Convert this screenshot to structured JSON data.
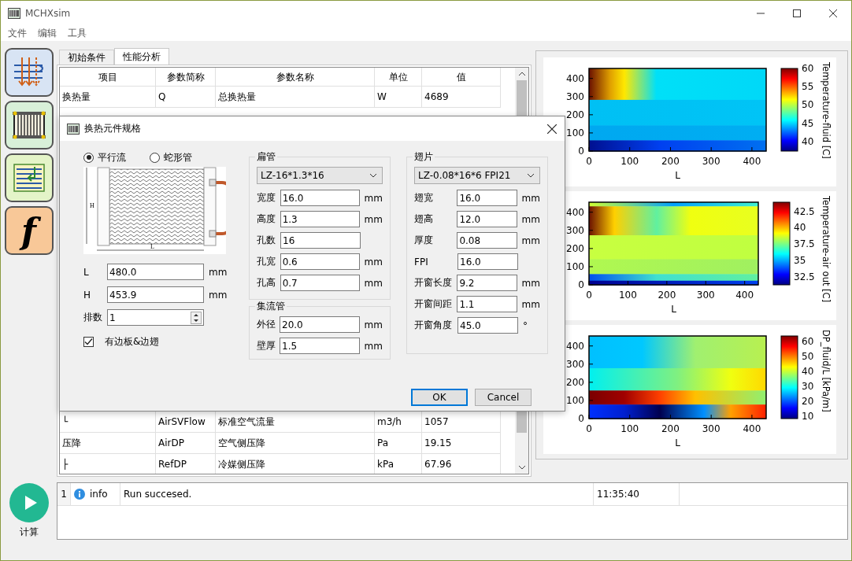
{
  "window": {
    "title": "MCHXsim"
  },
  "menu": [
    "文件",
    "编辑",
    "工具"
  ],
  "toolbar": [
    {
      "kind": "flow"
    },
    {
      "kind": "radiator"
    },
    {
      "kind": "list"
    },
    {
      "kind": "function",
      "label": "f"
    }
  ],
  "run_button": {
    "label": "计算"
  },
  "tabs": [
    {
      "label": "初始条件",
      "selected": false
    },
    {
      "label": "性能分析",
      "selected": true
    }
  ],
  "table": {
    "columns": [
      "项目",
      "参数简称",
      "参数名称",
      "单位",
      "值"
    ],
    "rows": [
      [
        "换热量",
        "Q",
        "总换热量",
        "W",
        "4689"
      ]
    ],
    "rows_below": [
      [
        "└",
        "AirSVFlow",
        "标准空气流量",
        "m3/h",
        "1057"
      ],
      [
        "压降",
        "AirDP",
        "空气侧压降",
        "Pa",
        "19.15"
      ],
      [
        "├",
        "RefDP",
        "冷媒侧压降",
        "kPa",
        "67.96"
      ]
    ]
  },
  "plots": [
    {
      "title": "Temperature-fluid [C]",
      "xlabel": "L",
      "xticks": [
        "0",
        "100",
        "200",
        "300",
        "400"
      ],
      "yticks": [
        "400",
        "300",
        "200",
        "100",
        "0"
      ],
      "colorbar_ticks": [
        "60",
        "55",
        "50",
        "45",
        "40"
      ]
    },
    {
      "title": "Temperature-air out [C]",
      "xlabel": "L",
      "xticks": [
        "0",
        "100",
        "200",
        "300",
        "400"
      ],
      "yticks": [
        "400",
        "300",
        "200",
        "100",
        "0"
      ],
      "colorbar_ticks": [
        "42.5",
        "40",
        "37.5",
        "35",
        "32.5"
      ]
    },
    {
      "title": "DP_fluid/L [kPa/m]",
      "xlabel": "L",
      "xticks": [
        "0",
        "100",
        "200",
        "300",
        "400"
      ],
      "yticks": [
        "400",
        "300",
        "200",
        "100",
        "0"
      ],
      "colorbar_ticks": [
        "60",
        "50",
        "40",
        "30",
        "20",
        "10"
      ]
    }
  ],
  "log": {
    "rows": [
      {
        "line": "1",
        "kind": "info",
        "label": "info",
        "message": "Run succesed.",
        "time": "11:35:40"
      }
    ]
  },
  "dialog": {
    "title": "换热元件规格",
    "flow_types": [
      {
        "label": "平行流",
        "selected": true
      },
      {
        "label": "蛇形管",
        "selected": false
      }
    ],
    "diagram_labels": [
      "H",
      "L"
    ],
    "fields": [
      {
        "label": "L",
        "value": "480.0",
        "unit": "mm"
      },
      {
        "label": "H",
        "value": "453.9",
        "unit": "mm"
      }
    ],
    "rows_count": {
      "label": "排数",
      "value": "1"
    },
    "side_plates": {
      "label": "有边板&边翅",
      "checked": true
    },
    "groups": [
      {
        "title": "扁管",
        "model": "LZ-16*1.3*16",
        "fields": [
          {
            "label": "宽度",
            "value": "16.0",
            "unit": "mm"
          },
          {
            "label": "高度",
            "value": "1.3",
            "unit": "mm"
          },
          {
            "label": "孔数",
            "value": "16"
          },
          {
            "label": "孔宽",
            "value": "0.6",
            "unit": "mm"
          },
          {
            "label": "孔高",
            "value": "0.7",
            "unit": "mm"
          }
        ]
      },
      {
        "title": "集流管",
        "fields": [
          {
            "label": "外径",
            "value": "20.0",
            "unit": "mm"
          },
          {
            "label": "壁厚",
            "value": "1.5",
            "unit": "mm"
          }
        ]
      },
      {
        "title": "翅片",
        "model": "LZ-0.08*16*6 FPI21",
        "fields": [
          {
            "label": "翅宽",
            "value": "16.0",
            "unit": "mm"
          },
          {
            "label": "翅高",
            "value": "12.0",
            "unit": "mm"
          },
          {
            "label": "厚度",
            "value": "0.08",
            "unit": "mm"
          },
          {
            "label": "FPI",
            "value": "16.0"
          },
          {
            "label": "开窗长度",
            "value": "9.2",
            "unit": "mm"
          },
          {
            "label": "开窗间距",
            "value": "1.1",
            "unit": "mm"
          },
          {
            "label": "开窗角度",
            "value": "45.0",
            "unit": "°"
          }
        ]
      }
    ],
    "buttons": [
      {
        "label": "OK",
        "default": true
      },
      {
        "label": "Cancel",
        "default": false
      }
    ]
  }
}
